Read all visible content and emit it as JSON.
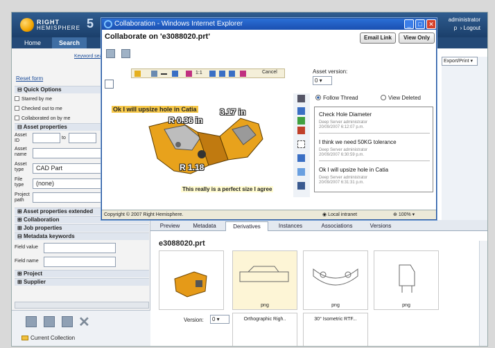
{
  "app": {
    "logo_line1": "RIGHT",
    "logo_line2": "HEMISPHERE",
    "logo_version": "5",
    "user": "administrator",
    "help": "p",
    "logout": "Logout"
  },
  "nav": {
    "home": "Home",
    "search": "Search"
  },
  "left": {
    "keyword_link": "Keyword sea",
    "reset_form": "Reset form",
    "quick_options": "Quick Options",
    "checks": [
      "Starred by me",
      "Checked out to me",
      "Collaborated on by me"
    ],
    "asset_properties": "Asset properties",
    "asset_id_label": "Asset ID",
    "to_label": "to",
    "asset_name_label": "Asset name",
    "asset_type_label": "Asset type",
    "asset_type_value": "CAD Part",
    "file_type_label": "File type",
    "file_type_value": "(none)",
    "project_path_label": "Project path",
    "sections": [
      "Asset properties extended",
      "Collaboration",
      "Job properties",
      "Metadata keywords"
    ],
    "field_value_label": "Field value",
    "field_name_label": "Field name",
    "project": "Project",
    "supplier": "Supplier",
    "current_collection": "Current Collection"
  },
  "right": {
    "export_print": "Export/Print"
  },
  "tabs": [
    "Preview",
    "Metadata",
    "Derivatives",
    "Instances",
    "Associations",
    "Versions"
  ],
  "derivatives": {
    "filename": "e3088020.prt",
    "thumb_captions": [
      "png",
      "png",
      "png"
    ],
    "version_label": "Version:",
    "version_value": "0",
    "row2_captions": [
      "Orthographic Righ..",
      "30° Isometric RTF..."
    ]
  },
  "ie": {
    "title": "Collaboration - Windows Internet Explorer",
    "heading": "Collaborate on 'e3088020.prt'",
    "email_link": "Email Link",
    "view_only": "View Only",
    "toolbar_scale": "1:1",
    "cancel": "Cancel",
    "asset_version_label": "Asset version:",
    "asset_version_value": "0",
    "follow_thread": "Follow Thread",
    "view_deleted": "View Deleted",
    "messages": [
      {
        "text": "Check Hole Diameter",
        "author": "Deep Server administrator",
        "time": "20/09/2007 6:12:07 p.m."
      },
      {
        "text": "I think we need 50KG tolerance",
        "author": "Deep Server administrator",
        "time": "20/09/2007 6:30:59 p.m."
      },
      {
        "text": "Ok I will upsize hole in Catia",
        "author": "Deep Server administrator",
        "time": "20/09/2007 6:31:31 p.m."
      }
    ],
    "annotations": {
      "a1": "Ok I will upsize hole  in Catia",
      "a2": "R 0.36 in",
      "a3": "3.17 in",
      "a4": "R 1.18",
      "a5": "This really is a perfect size I agree"
    },
    "status_copyright": "Copyright © 2007 Right Hemisphere.",
    "status_zone": "Local intranet",
    "status_zoom": "100%"
  },
  "colors": {
    "accent": "#1b3f6b",
    "highlight": "#f7c94a",
    "ie_title": "#2b6fd6"
  }
}
